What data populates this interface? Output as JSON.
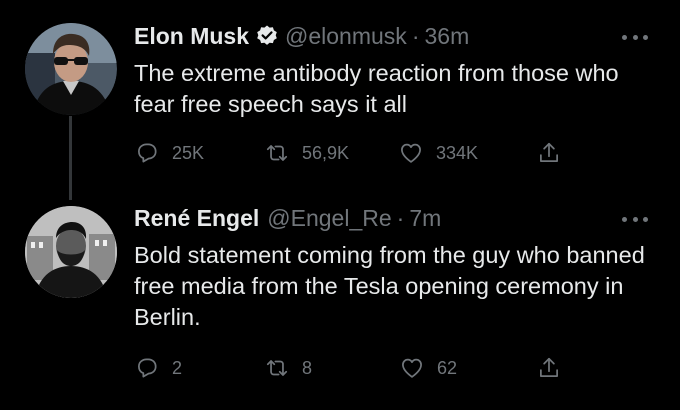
{
  "thread": [
    {
      "author": {
        "name": "Elon Musk",
        "handle": "@elonmusk",
        "verified": true
      },
      "dot": "·",
      "time": "36m",
      "text": "The extreme antibody reaction from those who fear free speech says it all",
      "stats": {
        "replies": "25K",
        "retweets": "56,9K",
        "likes": "334K"
      }
    },
    {
      "author": {
        "name": "René Engel",
        "handle": "@Engel_Re",
        "verified": false
      },
      "dot": "·",
      "time": "7m",
      "text": "Bold statement coming from the guy who banned free media from the Tesla opening ceremony in Berlin.",
      "stats": {
        "replies": "2",
        "retweets": "8",
        "likes": "62"
      }
    }
  ],
  "colors": {
    "background": "#000000",
    "text_primary": "#e7e9ea",
    "text_secondary": "#71767b",
    "verified_badge": "#e7e9ea",
    "thread_line": "#333639"
  },
  "icons": [
    "verified-badge-icon",
    "more-icon",
    "reply-icon",
    "retweet-icon",
    "like-icon",
    "share-icon"
  ]
}
